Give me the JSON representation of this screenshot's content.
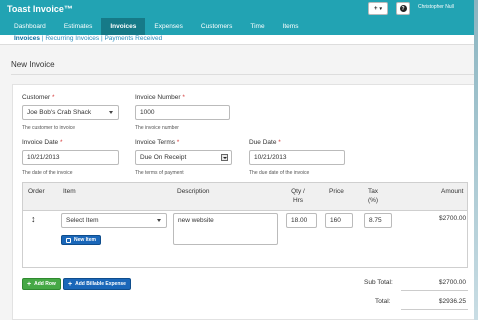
{
  "app": {
    "brand": "Toast Invoice™",
    "header": {
      "plus_label": "+",
      "plus_caret": "▾",
      "help_label": "?",
      "user_name": "Christopher Null"
    },
    "nav": [
      {
        "label": "Dashboard",
        "active": false
      },
      {
        "label": "Estimates",
        "active": false
      },
      {
        "label": "Invoices",
        "active": true
      },
      {
        "label": "Expenses",
        "active": false
      },
      {
        "label": "Customers",
        "active": false
      },
      {
        "label": "Time",
        "active": false
      },
      {
        "label": "Items",
        "active": false
      }
    ],
    "subnav": {
      "item1": "Invoices",
      "sep1": " | ",
      "item2": "Recurring Invoices",
      "sep2": " | ",
      "item3": "Payments Received"
    }
  },
  "page": {
    "title": "New Invoice"
  },
  "form": {
    "customer": {
      "label": "Customer",
      "required_mark": "*",
      "value": "Joe Bob's Crab Shack",
      "hint": "The customer to invoice"
    },
    "invoice_number": {
      "label": "Invoice Number",
      "required_mark": "*",
      "value": "1000",
      "hint": "The invoice number"
    },
    "invoice_date": {
      "label": "Invoice Date",
      "required_mark": "*",
      "value": "10/21/2013",
      "hint": "The date of the invoice"
    },
    "invoice_terms": {
      "label": "Invoice Terms",
      "required_mark": "*",
      "value": "Due On Receipt",
      "hint": "The terms of payment"
    },
    "due_date": {
      "label": "Due Date",
      "required_mark": "*",
      "value": "10/21/2013",
      "hint": "The due date of the invoice"
    }
  },
  "line_items": {
    "columns": {
      "order": "Order",
      "item": "Item",
      "description": "Description",
      "qty_line1": "Qty /",
      "qty_line2": "Hrs",
      "price": "Price",
      "tax_line1": "Tax",
      "tax_line2": "(%)",
      "amount": "Amount"
    },
    "row": {
      "order_icon": "move-icon",
      "order_glyph": "↕",
      "item_placeholder": "Select Item",
      "new_item_label": "New Item",
      "description": "new website",
      "qty": "18.00",
      "price": "160",
      "tax": "8.75",
      "amount": "$2700.00"
    }
  },
  "actions": {
    "add_row_label": "Add Row",
    "add_billable_label": "Add Billable Expense"
  },
  "totals": {
    "subtotal_label": "Sub Total:",
    "subtotal_value": "$2700.00",
    "total_label": "Total:",
    "total_value": "$2936.25"
  },
  "colors": {
    "header": "#22a3b3",
    "nav_active": "#167a88",
    "primary_button": "#1a67b9",
    "success_button": "#45a845",
    "required": "#d63a3a"
  }
}
